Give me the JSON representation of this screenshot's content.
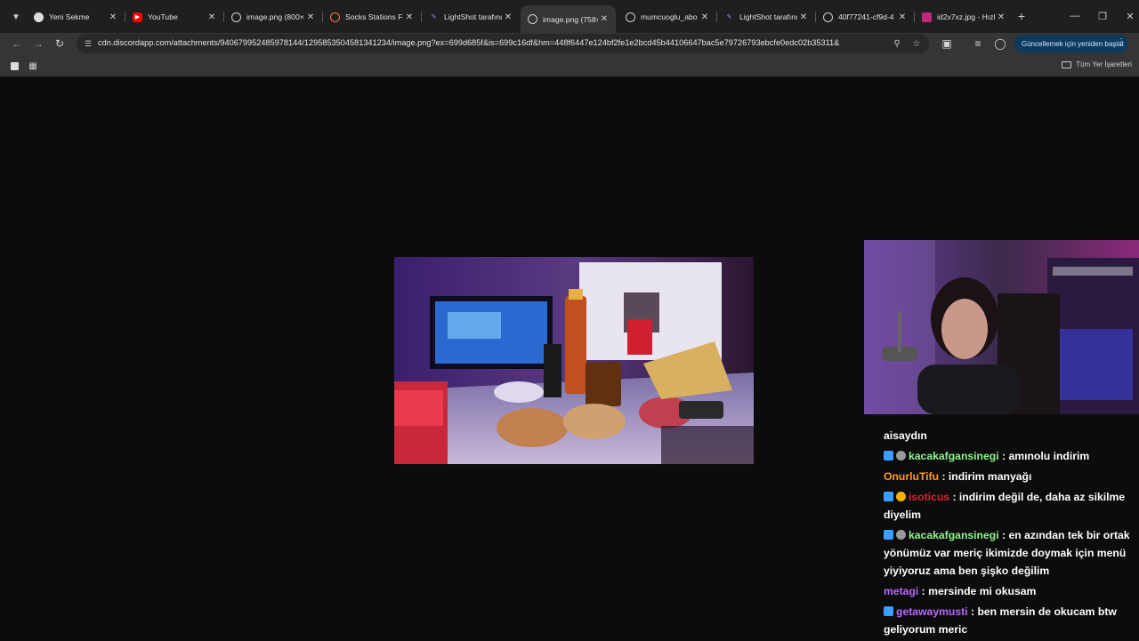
{
  "tabs": [
    {
      "title": "Yeni Sekme",
      "favicon": "chrome-icon"
    },
    {
      "title": "YouTube",
      "favicon": "youtube-icon"
    },
    {
      "title": "image.png (800×",
      "favicon": "globe-icon"
    },
    {
      "title": "Socks Stations Fa",
      "favicon": "socks-icon"
    },
    {
      "title": "LightShot tarafınd",
      "favicon": "feather-icon"
    },
    {
      "title": "image.png (758×",
      "favicon": "globe-icon"
    },
    {
      "title": "mumcuoglu_abo",
      "favicon": "globe-icon"
    },
    {
      "title": "LightShot tarafınd",
      "favicon": "feather-icon"
    },
    {
      "title": "40f77241-cf9d-4",
      "favicon": "globe-icon"
    },
    {
      "title": "id2x7xz.jpg - Hızl",
      "favicon": "imgur-icon"
    }
  ],
  "omnibox": {
    "url": "cdn.discordapp.com/attachments/940679952485978144/1295853504581341234/image.png?ex=699d685f&is=699c16df&hm=448f6447e124bf2fe1e2bcd45b44106647bac5e79726793ebcfe0edc02b35311&"
  },
  "update_button": {
    "label": "Güncellemek için yeniden başlat"
  },
  "bookmarks": {
    "all_label": "Tüm Yer İşaretleri"
  },
  "chat": [
    {
      "user": "",
      "text": "aisaydın",
      "user_color": "#ffffff",
      "badges": []
    },
    {
      "user": "kacakafgansinegi",
      "text": " : amınolu indirim",
      "user_color": "#8cf58c",
      "badges": [
        "#3aa0ff",
        "#9a9a9a"
      ]
    },
    {
      "user": "OnurluTifu",
      "text": " : indirim manyağı",
      "user_color": "#ff9a1f",
      "badges": []
    },
    {
      "user": "isoticus",
      "text": " : indirim değil de, daha az sikilme diyelim",
      "user_color": "#e0202f",
      "badges": [
        "#3aa0ff",
        "#f2b300"
      ]
    },
    {
      "user": "kacakafgansinegi",
      "text": " : en azından tek bir ortak yönümüz var meriç ikimizde doymak için menü yiyiyoruz ama ben şişko değilim",
      "user_color": "#8cf58c",
      "badges": [
        "#3aa0ff",
        "#9a9a9a"
      ]
    },
    {
      "user": "metagi",
      "text": " : mersinde mi okusam",
      "user_color": "#b667ff",
      "badges": []
    },
    {
      "user": "getawaymusti",
      "text": " : ben mersin de okucam btw geliyorum meric",
      "user_color": "#b667ff",
      "badges": [
        "#3aa0ff"
      ]
    }
  ]
}
